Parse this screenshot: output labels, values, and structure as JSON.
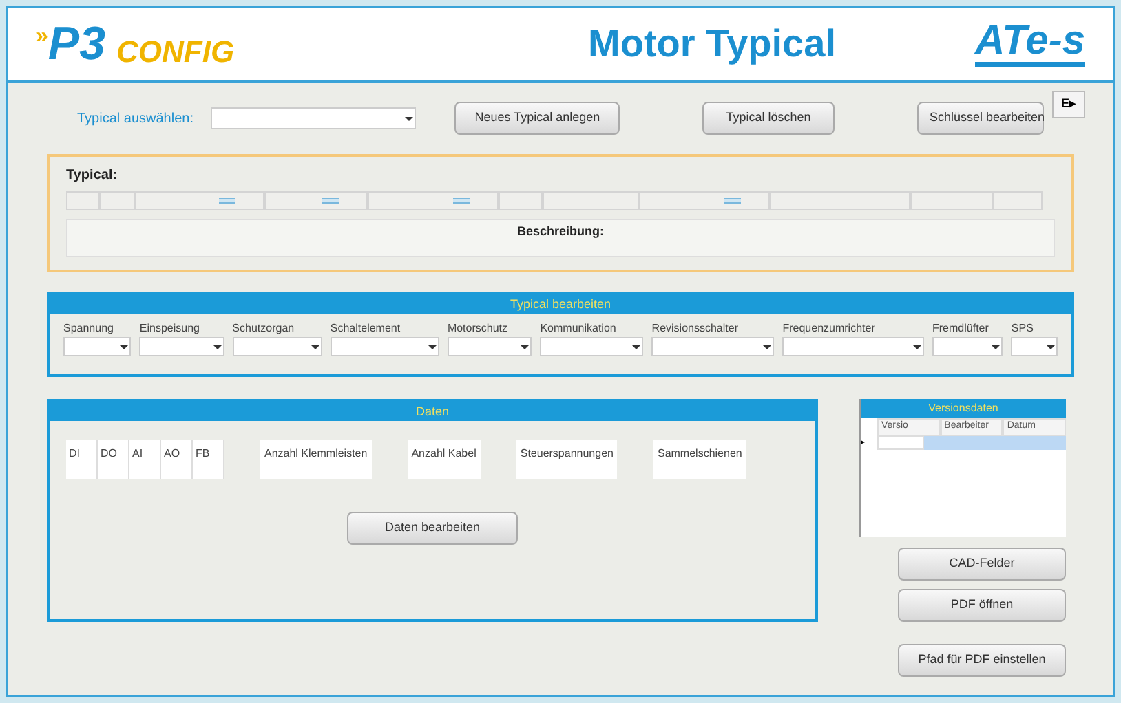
{
  "header": {
    "logo_mark": "»",
    "logo_main": "P3",
    "logo_sub": "CONFIG",
    "title": "Motor Typical",
    "brand": "ATe-s"
  },
  "toolbar": {
    "select_label": "Typical auswählen:",
    "buttons": [
      "Neues Typical anlegen",
      "Typical löschen",
      "Schlüssel bearbeiten"
    ],
    "logout_icon_label": "E▸"
  },
  "typical": {
    "label": "Typical:",
    "cells": [
      {
        "marked": false
      },
      {
        "marked": false
      },
      {
        "marked": true
      },
      {
        "marked": true
      },
      {
        "marked": true
      },
      {
        "marked": false
      },
      {
        "marked": false
      },
      {
        "marked": true
      },
      {
        "marked": false
      },
      {
        "marked": false
      },
      {
        "marked": false
      }
    ],
    "description_label": "Beschreibung:"
  },
  "edit_panel": {
    "title": "Typical bearbeiten",
    "fields": [
      "Spannung",
      "Einspeisung",
      "Schutzorgan",
      "Schaltelement",
      "Motorschutz",
      "Kommunikation",
      "Revisionsschalter",
      "Frequenzumrichter",
      "Fremdlüfter",
      "SPS"
    ]
  },
  "data_panel": {
    "title": "Daten",
    "io_fields": [
      "DI",
      "DO",
      "AI",
      "AO",
      "FB"
    ],
    "count_fields": [
      "Anzahl Klemmleisten",
      "Anzahl Kabel",
      "Steuerspannungen",
      "Sammelschienen"
    ],
    "button": "Daten bearbeiten"
  },
  "version_panel": {
    "title": "Versionsdaten",
    "columns": [
      "Versio",
      "Bearbeiter",
      "Datum"
    ],
    "row_marker": "▸"
  },
  "side_buttons": [
    "CAD-Felder",
    "PDF öffnen",
    "Pfad für PDF einstellen"
  ]
}
